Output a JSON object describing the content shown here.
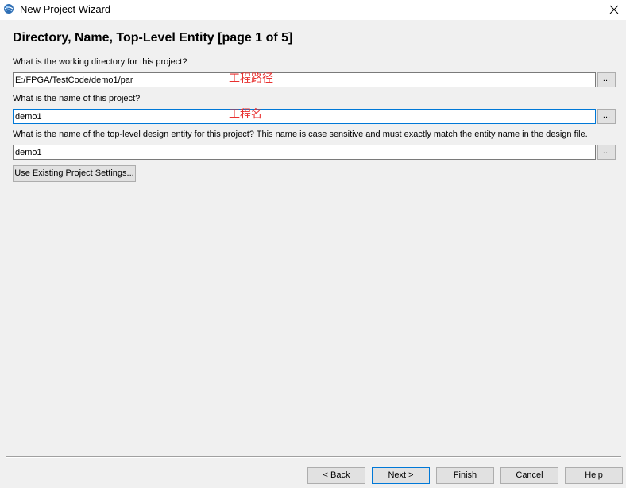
{
  "window": {
    "title": "New Project Wizard",
    "app_icon": "quartus-globe-icon",
    "close_icon": "close-icon"
  },
  "page": {
    "heading": "Directory, Name, Top-Level Entity [page 1 of 5]"
  },
  "fields": {
    "directory": {
      "question": "What is the working directory for this project?",
      "value": "E:/FPGA/TestCode/demo1/par",
      "browse_label": "...",
      "annotation": "工程路径"
    },
    "project_name": {
      "question": "What is the name of this project?",
      "value": "demo1",
      "browse_label": "...",
      "annotation": "工程名"
    },
    "top_level": {
      "question": "What is the name of the top-level design entity for this project? This name is case sensitive and must exactly match the entity name in the design file.",
      "value": "demo1",
      "browse_label": "..."
    }
  },
  "use_existing_label": "Use Existing Project Settings...",
  "footer": {
    "back": "< Back",
    "next": "Next >",
    "finish": "Finish",
    "cancel": "Cancel",
    "help": "Help"
  },
  "colors": {
    "annotation": "#e8302f",
    "focus_border": "#0078d7"
  }
}
